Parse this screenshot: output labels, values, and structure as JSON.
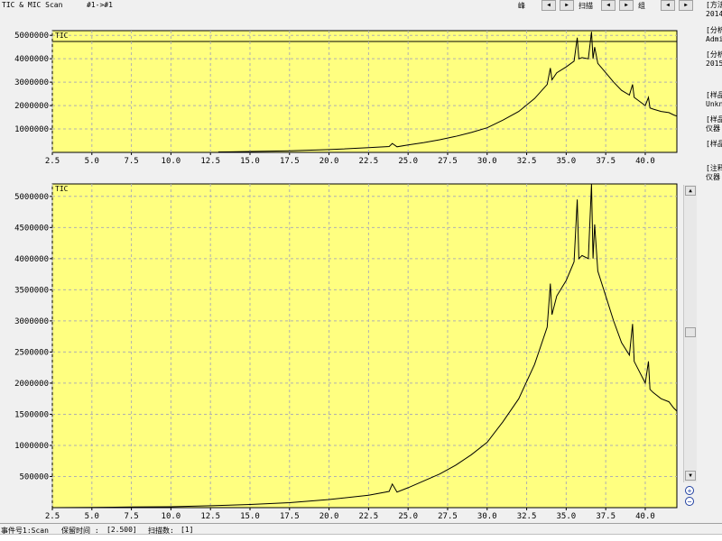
{
  "toolbar": {
    "title": "TIC & MIC Scan",
    "range": "#1->#1",
    "peak_label": "峰",
    "scan_label": "扫描",
    "group_label": "组"
  },
  "sidebar": {
    "items": [
      "[方法",
      "2014",
      "[分析",
      "Admi",
      "[分析",
      "2015",
      "[样品",
      "Unkn",
      "[样品",
      "仪器",
      "[样品",
      "[注释",
      "仪器"
    ]
  },
  "status": {
    "event": "事件号1:Scan",
    "retention_label": "保留时间 :",
    "retention_value": "[2.500]",
    "scans_label": "扫描数:",
    "scans_value": "[1]"
  },
  "chart_data": [
    {
      "type": "line",
      "title": "TIC",
      "xlim": [
        2.5,
        42
      ],
      "ylim": [
        0,
        5200000
      ],
      "xticks": [
        2.5,
        5.0,
        7.5,
        10.0,
        12.5,
        15.0,
        17.5,
        20.0,
        22.5,
        25.0,
        27.5,
        30.0,
        32.5,
        35.0,
        37.5,
        40.0
      ],
      "xtick_labels": [
        "2.5",
        "5.0",
        "7.5",
        "10.0",
        "12.5",
        "15.0",
        "17.5",
        "20.0",
        "22.5",
        "25.0",
        "27.5",
        "30.0",
        "32.5",
        "35.0",
        "37.5",
        "40.0"
      ],
      "yticks": [
        1000000,
        2000000,
        3000000,
        4000000,
        5000000
      ],
      "ytick_labels": [
        "1000000",
        "2000000",
        "3000000",
        "4000000",
        "5000000"
      ],
      "grid": true,
      "background": "#ffff80",
      "line_color": "#000000",
      "x": [
        13.0,
        15.0,
        17.5,
        20.0,
        22.5,
        23.8,
        24.0,
        24.3,
        25.0,
        26.0,
        27.0,
        28.0,
        29.0,
        30.0,
        31.0,
        32.0,
        33.0,
        33.8,
        34.0,
        34.1,
        34.4,
        35.0,
        35.5,
        35.7,
        35.8,
        36.0,
        36.4,
        36.6,
        36.7,
        36.8,
        37.0,
        37.5,
        38.0,
        38.5,
        39.0,
        39.2,
        39.3,
        39.5,
        40.0,
        40.2,
        40.3,
        40.5,
        41.0,
        41.5,
        41.8,
        42.0
      ],
      "y": [
        20000,
        40000,
        70000,
        120000,
        200000,
        250000,
        380000,
        240000,
        320000,
        420000,
        540000,
        680000,
        850000,
        1050000,
        1380000,
        1750000,
        2300000,
        2900000,
        3600000,
        3100000,
        3400000,
        3650000,
        3900000,
        4900000,
        4000000,
        4050000,
        4000000,
        5150000,
        4000000,
        4500000,
        3800000,
        3400000,
        3000000,
        2650000,
        2450000,
        2900000,
        2350000,
        2250000,
        2000000,
        2350000,
        1900000,
        1850000,
        1750000,
        1700000,
        1600000,
        1550000
      ]
    },
    {
      "type": "line",
      "title": "TIC",
      "xlim": [
        2.5,
        42
      ],
      "ylim": [
        0,
        5200000
      ],
      "xticks": [
        2.5,
        5.0,
        7.5,
        10.0,
        12.5,
        15.0,
        17.5,
        20.0,
        22.5,
        25.0,
        27.5,
        30.0,
        32.5,
        35.0,
        37.5,
        40.0
      ],
      "xtick_labels": [
        "2.5",
        "5.0",
        "7.5",
        "10.0",
        "12.5",
        "15.0",
        "17.5",
        "20.0",
        "22.5",
        "25.0",
        "27.5",
        "30.0",
        "32.5",
        "35.0",
        "37.5",
        "40.0"
      ],
      "yticks": [
        500000,
        1000000,
        1500000,
        2000000,
        2500000,
        3000000,
        3500000,
        4000000,
        4500000,
        5000000
      ],
      "ytick_labels": [
        "500000",
        "1000000",
        "1500000",
        "2000000",
        "2500000",
        "3000000",
        "3500000",
        "4000000",
        "4500000",
        "5000000"
      ],
      "grid": true,
      "background": "#ffff80",
      "line_color": "#000000",
      "x": [
        2.5,
        5.0,
        7.5,
        10.0,
        12.5,
        15.0,
        17.5,
        20.0,
        22.5,
        23.8,
        24.0,
        24.3,
        25.0,
        26.0,
        27.0,
        28.0,
        29.0,
        30.0,
        31.0,
        32.0,
        33.0,
        33.8,
        34.0,
        34.1,
        34.4,
        35.0,
        35.5,
        35.7,
        35.8,
        36.0,
        36.4,
        36.6,
        36.7,
        36.8,
        37.0,
        37.5,
        38.0,
        38.5,
        39.0,
        39.2,
        39.3,
        39.5,
        40.0,
        40.2,
        40.3,
        40.5,
        41.0,
        41.5,
        41.8,
        42.0
      ],
      "y": [
        0,
        5000,
        10000,
        15000,
        30000,
        50000,
        80000,
        130000,
        200000,
        260000,
        380000,
        250000,
        320000,
        430000,
        540000,
        680000,
        850000,
        1050000,
        1380000,
        1750000,
        2300000,
        2900000,
        3600000,
        3100000,
        3400000,
        3650000,
        3950000,
        4950000,
        4000000,
        4050000,
        4000000,
        5200000,
        4000000,
        4550000,
        3800000,
        3400000,
        3000000,
        2650000,
        2450000,
        2950000,
        2350000,
        2250000,
        2000000,
        2350000,
        1900000,
        1850000,
        1750000,
        1700000,
        1600000,
        1550000
      ]
    }
  ]
}
